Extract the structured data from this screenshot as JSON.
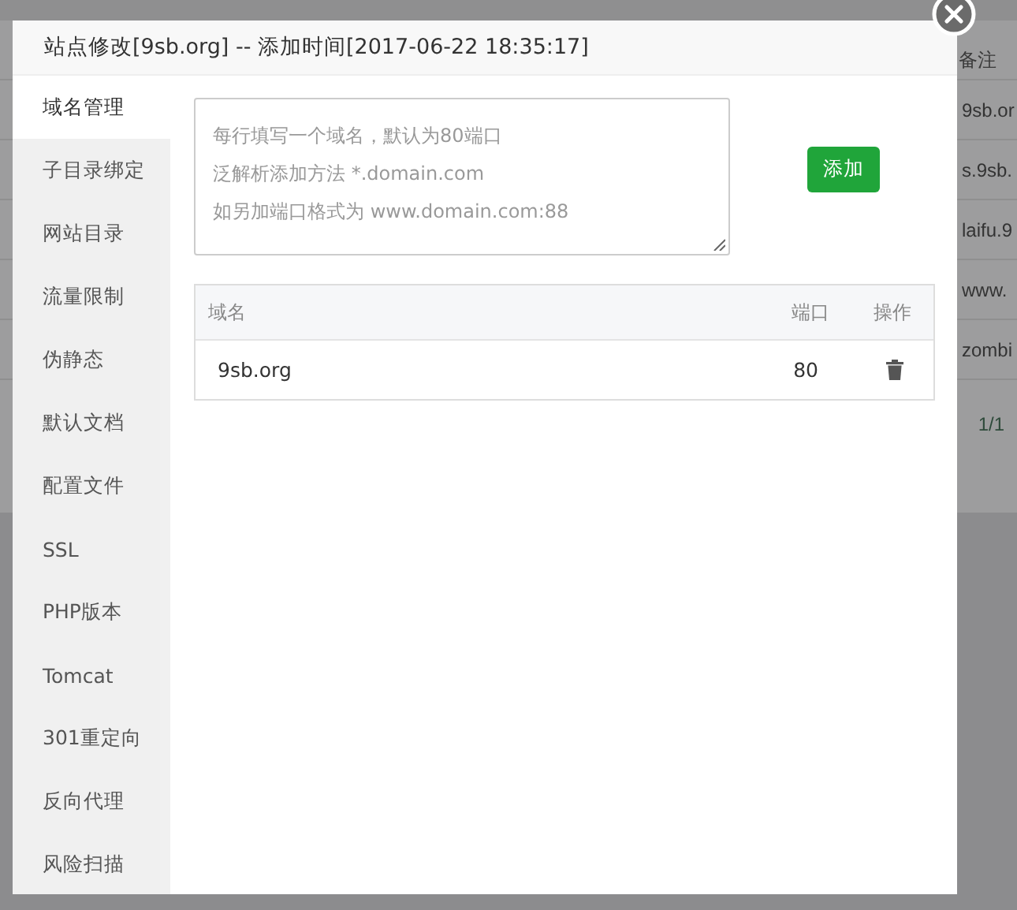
{
  "background": {
    "column_header": "备注",
    "rows": [
      "9sb.or",
      "s.9sb.",
      "laifu.9",
      "www.",
      "zombi"
    ],
    "pagination": "1/1"
  },
  "dialog": {
    "title": "站点修改[9sb.org] -- 添加时间[2017-06-22 18:35:17]",
    "sidebar": [
      {
        "label": "域名管理",
        "selected": true
      },
      {
        "label": "子目录绑定",
        "selected": false
      },
      {
        "label": "网站目录",
        "selected": false
      },
      {
        "label": "流量限制",
        "selected": false
      },
      {
        "label": "伪静态",
        "selected": false
      },
      {
        "label": "默认文档",
        "selected": false
      },
      {
        "label": "配置文件",
        "selected": false
      },
      {
        "label": "SSL",
        "selected": false
      },
      {
        "label": "PHP版本",
        "selected": false
      },
      {
        "label": "Tomcat",
        "selected": false
      },
      {
        "label": "301重定向",
        "selected": false
      },
      {
        "label": "反向代理",
        "selected": false
      },
      {
        "label": "风险扫描",
        "selected": false
      }
    ],
    "domain_input": {
      "placeholder_lines": [
        "每行填写一个域名，默认为80端口",
        "泛解析添加方法 *.domain.com",
        "如另加端口格式为 www.domain.com:88"
      ]
    },
    "add_button": "添加",
    "table": {
      "columns": [
        "域名",
        "端口",
        "操作"
      ],
      "rows": [
        {
          "domain": "9sb.org",
          "port": "80"
        }
      ]
    }
  }
}
